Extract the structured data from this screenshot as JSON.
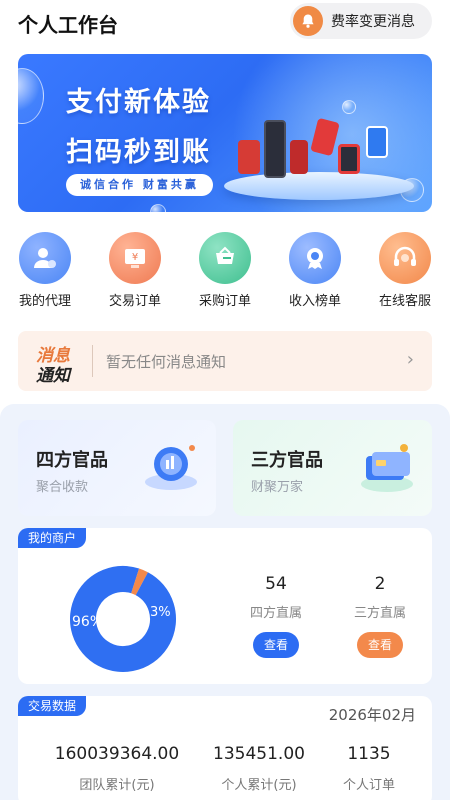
{
  "header": {
    "title": "个人工作台",
    "rate_notice_label": "费率变更消息"
  },
  "banner": {
    "headline1": "支付新体验",
    "headline2": "扫码秒到账",
    "slogan": "诚信合作 财富共赢"
  },
  "actions": [
    {
      "label": "我的代理",
      "icon": "agent-icon",
      "color": "#4b86f5"
    },
    {
      "label": "交易订单",
      "icon": "order-icon",
      "color": "#ef7a52"
    },
    {
      "label": "采购订单",
      "icon": "cart-icon",
      "color": "#3fbf8f"
    },
    {
      "label": "收入榜单",
      "icon": "ranking-icon",
      "color": "#4b86f5"
    },
    {
      "label": "在线客服",
      "icon": "headset-icon",
      "color": "#f2884a"
    }
  ],
  "notice": {
    "logo_top": "消息",
    "logo_bottom": "通知",
    "text": "暂无任何消息通知"
  },
  "products": [
    {
      "title": "四方官品",
      "subtitle": "聚合收款"
    },
    {
      "title": "三方官品",
      "subtitle": "财聚万家"
    }
  ],
  "merchants": {
    "tag": "我的商户",
    "donut": {
      "segments": [
        {
          "label": "96%",
          "value": 96,
          "color": "#2f6ff2"
        },
        {
          "label": "3%",
          "value": 3,
          "color": "#f3894b"
        }
      ]
    },
    "four": {
      "count": "54",
      "label": "四方直属",
      "button": "查看"
    },
    "three": {
      "count": "2",
      "label": "三方直属",
      "button": "查看"
    }
  },
  "trade": {
    "tag": "交易数据",
    "date": "2026年02月",
    "team_total": "160039364.00",
    "team_label": "团队累计(元)",
    "personal_total": "135451.00",
    "personal_label": "个人累计(元)",
    "orders": "1135",
    "orders_label": "个人订单"
  },
  "colors": {
    "accent": "#2c6cf3",
    "orange": "#f3894b"
  }
}
